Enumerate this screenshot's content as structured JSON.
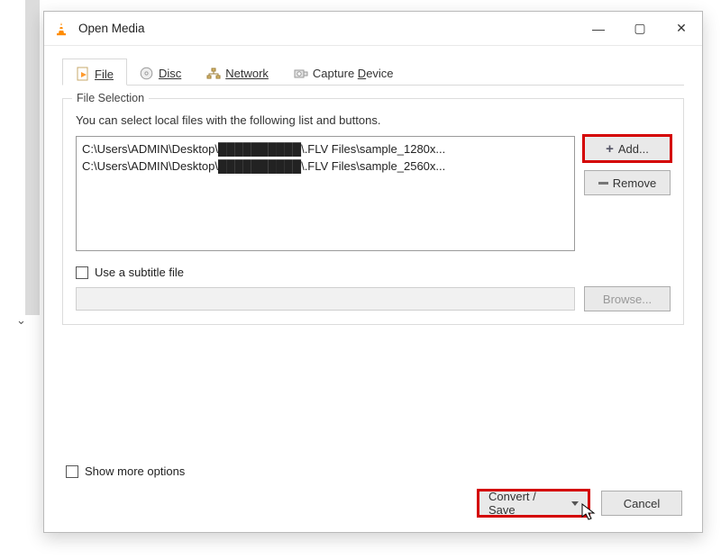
{
  "window": {
    "title": "Open Media",
    "controls": {
      "minimize": "—",
      "maximize": "▢",
      "close": "✕"
    }
  },
  "tabs": {
    "file": "File",
    "disc": "Disc",
    "network": "Network",
    "capture": "Capture Device"
  },
  "file_selection": {
    "legend": "File Selection",
    "helper": "You can select local files with the following list and buttons.",
    "files": [
      "C:\\Users\\ADMIN\\Desktop\\██████████\\.FLV Files\\sample_1280x...",
      "C:\\Users\\ADMIN\\Desktop\\██████████\\.FLV Files\\sample_2560x..."
    ],
    "add_label": "Add...",
    "remove_label": "Remove"
  },
  "subtitle": {
    "checkbox_label": "Use a subtitle file",
    "browse_label": "Browse..."
  },
  "more_options": {
    "label": "Show more options"
  },
  "footer": {
    "convert_save": "Convert / Save",
    "cancel": "Cancel"
  }
}
